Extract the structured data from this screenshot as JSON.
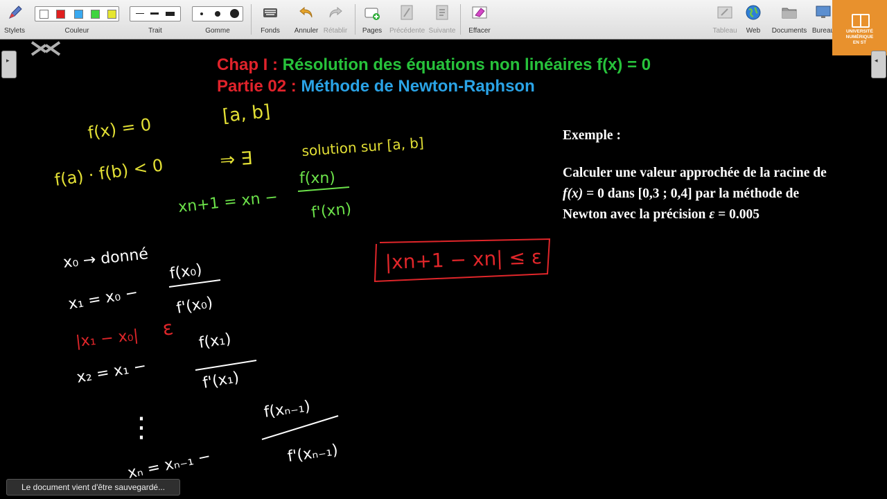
{
  "toolbar": {
    "pens": "Stylets",
    "color": "Couleur",
    "stroke": "Trait",
    "eraser": "Gomme",
    "backgrounds": "Fonds",
    "undo": "Annuler",
    "redo": "Rétablir",
    "pages": "Pages",
    "previous": "Précédente",
    "next": "Suivante",
    "clear": "Effacer",
    "board": "Tableau",
    "web": "Web",
    "documents": "Documents",
    "desktop": "Bureau"
  },
  "colors": {
    "white": "#ffffff",
    "red": "#e02020",
    "blue": "#39a9f0",
    "green": "#3fd43f",
    "yellow": "#e6e630",
    "ink_yellow": "#e3e035",
    "ink_green": "#6ce24a",
    "ink_red": "#e0262a",
    "ink_white": "#ffffff"
  },
  "logo": {
    "text": "UNIVERSITÉ\nNUMÉRIQUE\nEN ST"
  },
  "header": {
    "line1_prefix": "Chap I :",
    "line1_text": "Résolution des équations non linéaires f(x) = 0",
    "line2_prefix": "Partie 02 :",
    "line2_text": "Méthode de Newton-Raphson"
  },
  "example": {
    "heading": "Exemple :",
    "line1": "Calculer une valeur approchée de la racine de",
    "fx": "f(x)",
    "line2_rest": "= 0 dans [0,3 ; 0,4] par la méthode de",
    "line3a": "Newton avec la précision",
    "epsilon": "ε",
    "line3b": "= 0.005"
  },
  "handwriting": {
    "eq_fx": "f(x) = 0",
    "interval": "[a, b]",
    "cond": "f(a) · f(b) < 0",
    "arrow_exists": "⇒ ∃",
    "solution": "solution sur [a, b]",
    "newton_lhs": "xn+1 = xn −",
    "newton_num": "f(xn)",
    "newton_den": "f'(xn)",
    "stop_rule": "|xn+1 − xn| ≤ ε",
    "x0": "x₀ → donné",
    "x1_lhs": "x₁ = x₀ −",
    "x1_num": "f(x₀)",
    "x1_den": "f'(x₀)",
    "abs1": "|x₁ − x₀|",
    "eps": "ε",
    "x2_lhs": "x₂ = x₁ −",
    "x2_num": "f(x₁)",
    "x2_den": "f'(x₁)",
    "dots": "⋮",
    "xn_lhs": "xₙ = xₙ₋₁ −",
    "xn_num": "f(xₙ₋₁)",
    "xn_den": "f'(xₙ₋₁)"
  },
  "status": "Le document vient d'être sauvegardé..."
}
